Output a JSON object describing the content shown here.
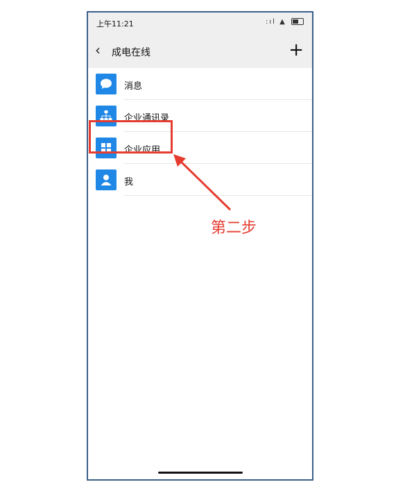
{
  "status_bar": {
    "time": "上午11:21",
    "signal_glyph": ":ıl",
    "wifi_glyph": "▲"
  },
  "header": {
    "back_icon": "‹",
    "title": "成电在线",
    "add_icon": "+"
  },
  "menu": {
    "items": [
      {
        "label": "消息",
        "icon": "chat-bubble-icon"
      },
      {
        "label": "企业通讯录",
        "icon": "org-chart-icon"
      },
      {
        "label": "企业应用",
        "icon": "grid-icon"
      },
      {
        "label": "我",
        "icon": "person-icon"
      }
    ]
  },
  "annotation": {
    "step_text": "第二步",
    "color": "#e53c2f"
  },
  "colors": {
    "icon_blue": "#1f87e5",
    "bar_gray": "#efefef",
    "frame": "#3b5f8a"
  }
}
